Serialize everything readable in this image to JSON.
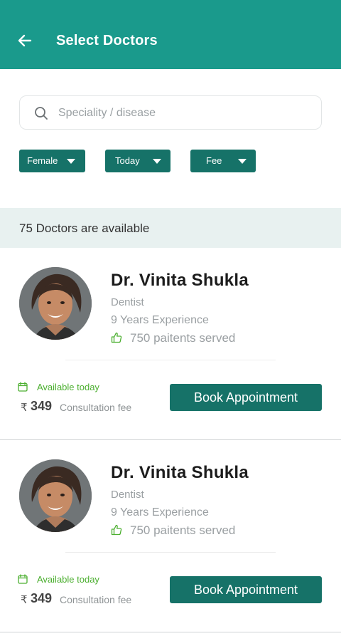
{
  "header": {
    "title": "Select Doctors",
    "back_icon": "arrow-left-icon",
    "background": "#1a9a8c"
  },
  "search": {
    "placeholder": "Speciality / disease",
    "value": "",
    "icon": "search-icon"
  },
  "filters": [
    {
      "label": "Female",
      "icon": "caret-down-icon"
    },
    {
      "label": "Today",
      "icon": "caret-down-icon"
    },
    {
      "label": "Fee",
      "icon": "caret-down-icon"
    }
  ],
  "results": {
    "count_text": "75 Doctors are available"
  },
  "doctors": [
    {
      "name": "Dr. Vinita Shukla",
      "speciality": "Dentist",
      "experience": "9 Years Experience",
      "served": "750 paitents served",
      "availability": "Available today",
      "currency": "₹",
      "fee": "349",
      "fee_label": "Consultation fee",
      "book_label": "Book Appointment"
    },
    {
      "name": "Dr. Vinita Shukla",
      "speciality": "Dentist",
      "experience": "9 Years Experience",
      "served": "750 paitents served",
      "availability": "Available today",
      "currency": "₹",
      "fee": "349",
      "fee_label": "Consultation fee",
      "book_label": "Book Appointment"
    }
  ],
  "colors": {
    "primary": "#1a9a8c",
    "button": "#167268",
    "available": "#4caf30",
    "count_bar": "#e8f1f0"
  }
}
